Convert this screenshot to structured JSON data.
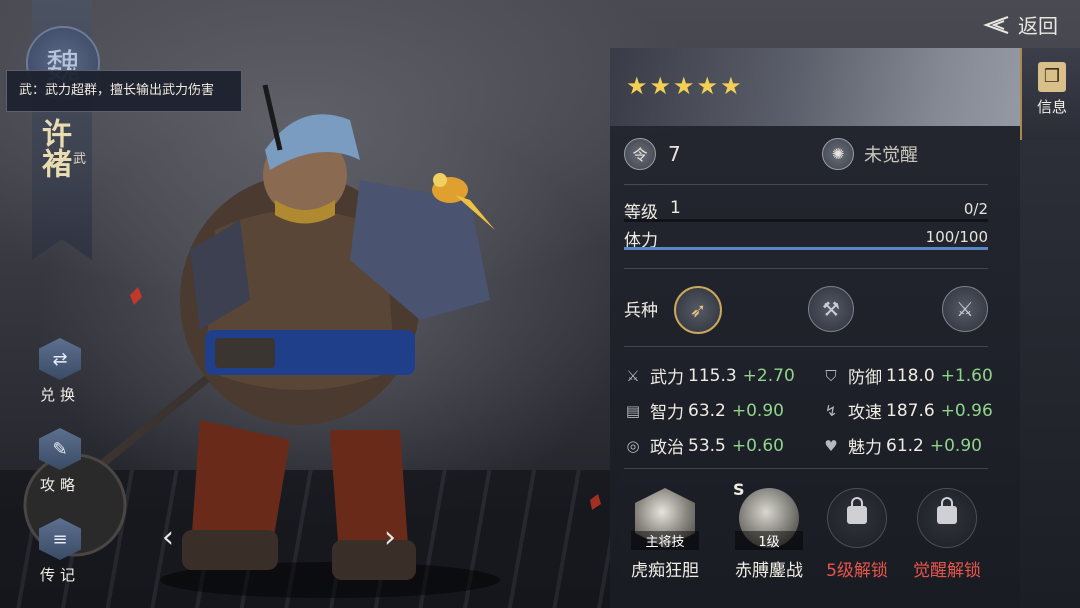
{
  "header": {
    "back_label": "返回"
  },
  "hero": {
    "kingdom": "魏",
    "name": "许褚",
    "type_tag": "武",
    "tooltip": "武：武力超群，擅长输出武力伤害"
  },
  "left_menu": [
    {
      "label": "兑换",
      "icon": "exchange-icon"
    },
    {
      "label": "攻略",
      "icon": "guide-scroll-icon"
    },
    {
      "label": "传记",
      "icon": "biography-icon"
    }
  ],
  "nav": {
    "prev": "‹",
    "next": "›"
  },
  "side_tab": {
    "label": "信息",
    "icon": "scroll-icon"
  },
  "panel": {
    "stars": 5,
    "order": {
      "icon_text": "令",
      "value": "7"
    },
    "awaken": {
      "label": "未觉醒"
    },
    "level": {
      "label": "等级",
      "value": "1",
      "exp_text": "0/2",
      "exp_fraction": 0.0
    },
    "stamina": {
      "label": "体力",
      "value_text": "100/100",
      "fraction": 1.0
    },
    "troop_label": "兵种",
    "troops": [
      {
        "icon": "spear-icon",
        "active": true
      },
      {
        "icon": "axe-icon",
        "active": false
      },
      {
        "icon": "halberd-icon",
        "active": false
      }
    ],
    "stats": [
      {
        "name": "武力",
        "value": "115.3",
        "bonus": "+2.70",
        "icon": "sword-icon"
      },
      {
        "name": "防御",
        "value": "118.0",
        "bonus": "+1.60",
        "icon": "shield-icon"
      },
      {
        "name": "智力",
        "value": "63.2",
        "bonus": "+0.90",
        "icon": "book-icon"
      },
      {
        "name": "攻速",
        "value": "187.6",
        "bonus": "+0.96",
        "icon": "boot-icon"
      },
      {
        "name": "政治",
        "value": "53.5",
        "bonus": "+0.60",
        "icon": "seal-icon"
      },
      {
        "name": "魅力",
        "value": "61.2",
        "bonus": "+0.90",
        "icon": "heart-icon"
      }
    ],
    "skills": [
      {
        "name": "虎痴狂胆",
        "tag": "主将技",
        "locked": false,
        "type": "main"
      },
      {
        "name": "赤膊鏖战",
        "tag": "1级",
        "badge": "S",
        "locked": false,
        "type": "normal"
      },
      {
        "name": "5级解锁",
        "locked": true,
        "type": "locked"
      },
      {
        "name": "觉醒解锁",
        "locked": true,
        "type": "locked"
      }
    ]
  },
  "colors": {
    "bonus": "#8fd48a",
    "locked_text": "#e8554a",
    "star": "#f2cf55",
    "bar": "#5a86c8"
  }
}
